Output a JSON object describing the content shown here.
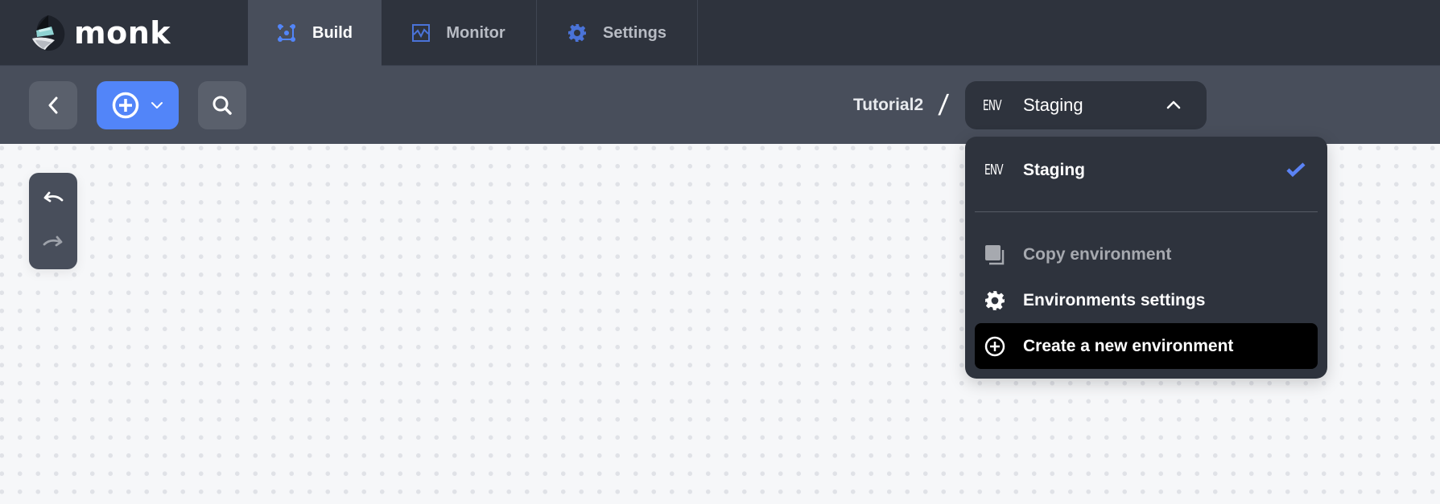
{
  "app": {
    "name": "monk",
    "logo_icon": "monk-hood-logo-icon"
  },
  "nav": {
    "tabs": [
      {
        "label": "Build",
        "icon": "build-graph-icon",
        "active": true
      },
      {
        "label": "Monitor",
        "icon": "monitor-chart-icon",
        "active": false
      },
      {
        "label": "Settings",
        "icon": "gear-icon",
        "active": false
      }
    ]
  },
  "toolbar": {
    "back_icon": "chevron-left-icon",
    "add_icon": "plus-circle-icon",
    "add_menu_icon": "chevron-down-icon",
    "search_icon": "search-icon"
  },
  "breadcrumb": {
    "project": "Tutorial2",
    "separator": "/"
  },
  "environment": {
    "tag": "ENV",
    "selected": "Staging",
    "open": true
  },
  "history": {
    "undo_icon": "undo-icon",
    "redo_icon": "redo-icon",
    "redo_enabled": false
  },
  "dropdown": {
    "environments": [
      {
        "tag": "ENV",
        "name": "Staging",
        "selected": true
      }
    ],
    "actions": [
      {
        "label": "Copy environment",
        "icon": "copy-icon",
        "disabled": true
      },
      {
        "label": "Environments settings",
        "icon": "gear-icon",
        "disabled": false
      },
      {
        "label": "Create a new environment",
        "icon": "plus-circle-icon",
        "disabled": false,
        "highlighted": true
      }
    ]
  },
  "colors": {
    "accent": "#5285f9",
    "topbar": "#2e333d",
    "subbar": "#484e5b",
    "canvas": "#f6f7f9",
    "check": "#5b83f5"
  }
}
